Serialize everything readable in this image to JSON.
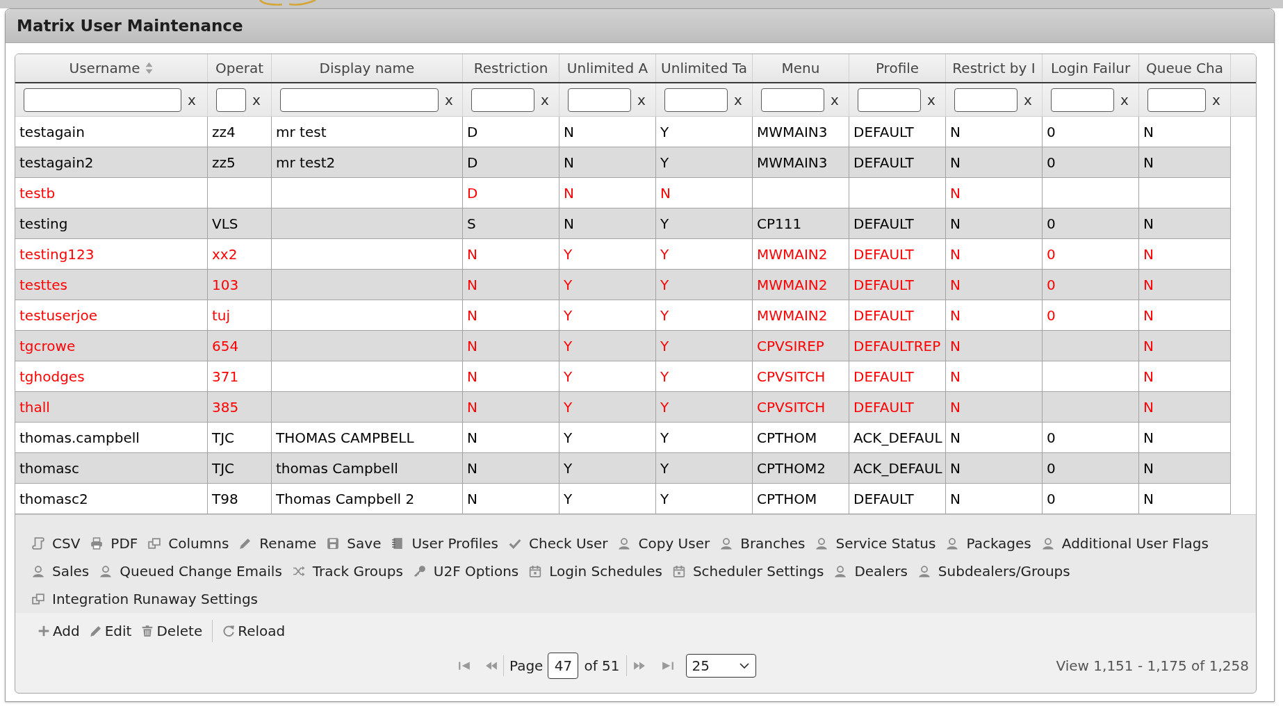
{
  "window": {
    "title": "Matrix User Maintenance"
  },
  "table": {
    "columns": [
      {
        "label": "Username",
        "sorted": true,
        "clear_label": "x"
      },
      {
        "label": "Operat",
        "sorted": false,
        "clear_label": "x"
      },
      {
        "label": "Display name",
        "sorted": false,
        "clear_label": "x"
      },
      {
        "label": "Restriction",
        "sorted": false,
        "clear_label": "x"
      },
      {
        "label": "Unlimited A",
        "sorted": false,
        "clear_label": "x"
      },
      {
        "label": "Unlimited Ta",
        "sorted": false,
        "clear_label": "x"
      },
      {
        "label": "Menu",
        "sorted": false,
        "clear_label": "x"
      },
      {
        "label": "Profile",
        "sorted": false,
        "clear_label": "x"
      },
      {
        "label": "Restrict by I",
        "sorted": false,
        "clear_label": "x"
      },
      {
        "label": "Login Failur",
        "sorted": false,
        "clear_label": "x"
      },
      {
        "label": "Queue Cha",
        "sorted": false,
        "clear_label": "x"
      }
    ],
    "rows": [
      {
        "color": "#000000",
        "username": "testagain",
        "column_2": "zz4",
        "display_name": "mr test",
        "restriction": "D",
        "column_5": "N",
        "column_6": "Y",
        "menu": "MWMAIN3",
        "profile": "DEFAULT",
        "column_9": "N",
        "column_10": "0",
        "column_11": "N"
      },
      {
        "color": "#000000",
        "username": "testagain2",
        "column_2": "zz5",
        "display_name": "mr test2",
        "restriction": "D",
        "column_5": "N",
        "column_6": "Y",
        "menu": "MWMAIN3",
        "profile": "DEFAULT",
        "column_9": "N",
        "column_10": "0",
        "column_11": "N"
      },
      {
        "color": "#ff0000",
        "username": "testb",
        "restriction": "D",
        "column_5": "N",
        "column_6": "N",
        "column_9": "N"
      },
      {
        "color": "#000000",
        "username": "testing",
        "column_2": "VLS",
        "restriction": "S",
        "column_5": "N",
        "column_6": "Y",
        "menu": "CP111",
        "profile": "DEFAULT",
        "column_9": "N",
        "column_10": "0",
        "column_11": "N"
      },
      {
        "color": "#ff0000",
        "username": "testing123",
        "column_2": "xx2",
        "restriction": "N",
        "column_5": "Y",
        "column_6": "Y",
        "menu": "MWMAIN2",
        "profile": "DEFAULT",
        "column_9": "N",
        "column_10": "0",
        "column_11": "N"
      },
      {
        "color": "#ff0000",
        "username": "testtes",
        "column_2": "103",
        "restriction": "N",
        "column_5": "Y",
        "column_6": "Y",
        "menu": "MWMAIN2",
        "profile": "DEFAULT",
        "column_9": "N",
        "column_10": "0",
        "column_11": "N"
      },
      {
        "color": "#ff0000",
        "username": "testuserjoe",
        "column_2": "tuj",
        "restriction": "N",
        "column_5": "Y",
        "column_6": "Y",
        "menu": "MWMAIN2",
        "profile": "DEFAULT",
        "column_9": "N",
        "column_10": "0",
        "column_11": "N"
      },
      {
        "color": "#ff0000",
        "username": "tgcrowe",
        "column_2": "654",
        "restriction": "N",
        "column_5": "Y",
        "column_6": "Y",
        "menu": "CPVSIREP",
        "profile": "DEFAULTREP",
        "column_9": "N",
        "column_11": "N"
      },
      {
        "color": "#ff0000",
        "username": "tghodges",
        "column_2": "371",
        "restriction": "N",
        "column_5": "Y",
        "column_6": "Y",
        "menu": "CPVSITCH",
        "profile": "DEFAULT",
        "column_9": "N",
        "column_11": "N"
      },
      {
        "color": "#ff0000",
        "username": "thall",
        "column_2": "385",
        "restriction": "N",
        "column_5": "Y",
        "column_6": "Y",
        "menu": "CPVSITCH",
        "profile": "DEFAULT",
        "column_9": "N",
        "column_11": "N"
      },
      {
        "color": "#000000",
        "username": "thomas.campbell",
        "column_2": "TJC",
        "display_name": "THOMAS CAMPBELL",
        "restriction": "N",
        "column_5": "Y",
        "column_6": "Y",
        "menu": "CPTHOM",
        "profile": "ACK_DEFAUL",
        "column_9": "N",
        "column_10": "0",
        "column_11": "N"
      },
      {
        "color": "#000000",
        "username": "thomasc",
        "column_2": "TJC",
        "display_name": "thomas Campbell",
        "restriction": "N",
        "column_5": "Y",
        "column_6": "Y",
        "menu": "CPTHOM2",
        "profile": "ACK_DEFAUL",
        "column_9": "N",
        "column_10": "0",
        "column_11": "N"
      },
      {
        "color": "#000000",
        "username": "thomasc2",
        "column_2": "T98",
        "display_name": "Thomas Campbell 2",
        "restriction": "N",
        "column_5": "Y",
        "column_6": "Y",
        "menu": "CPTHOM",
        "profile": "DEFAULT",
        "column_9": "N",
        "column_10": "0",
        "column_11": "N"
      }
    ]
  },
  "toolbar_rows": [
    [
      {
        "label": "CSV",
        "kind": "scroll"
      },
      {
        "label": "PDF",
        "kind": "printer"
      },
      {
        "label": "Columns",
        "kind": "windows"
      },
      {
        "label": "Rename",
        "kind": "pencil"
      },
      {
        "label": "Save",
        "kind": "floppy"
      },
      {
        "label": "User Profiles",
        "kind": "notebook"
      },
      {
        "label": "Check User",
        "kind": "check"
      },
      {
        "label": "Copy User",
        "kind": "person"
      },
      {
        "label": "Branches",
        "kind": "person"
      },
      {
        "label": "Service Status",
        "kind": "person"
      },
      {
        "label": "Packages",
        "kind": "person"
      },
      {
        "label": "Additional User Flags",
        "kind": "person"
      }
    ],
    [
      {
        "label": "Sales",
        "kind": "person"
      },
      {
        "label": "Queued Change Emails",
        "kind": "person"
      },
      {
        "label": "Track Groups",
        "kind": "shuffle"
      },
      {
        "label": "U2F Options",
        "kind": "key"
      },
      {
        "label": "Login Schedules",
        "kind": "calendar"
      },
      {
        "label": "Scheduler Settings",
        "kind": "calendar"
      },
      {
        "label": "Dealers",
        "kind": "person"
      },
      {
        "label": "Subdealers/Groups",
        "kind": "person"
      }
    ],
    [
      {
        "label": "Integration Runaway Settings",
        "kind": "windows"
      }
    ]
  ],
  "action_groups": [
    [
      {
        "label": "Add",
        "kind": "plus"
      },
      {
        "label": "Edit",
        "kind": "pencil"
      },
      {
        "label": "Delete",
        "kind": "trash"
      }
    ],
    [
      {
        "label": "Reload",
        "kind": "reload"
      }
    ]
  ],
  "pager": {
    "page_label": "Page",
    "page": "47",
    "total_label": "of 51",
    "page_size": "25",
    "summary": "View 1,151 - 1,175 of 1,258"
  }
}
